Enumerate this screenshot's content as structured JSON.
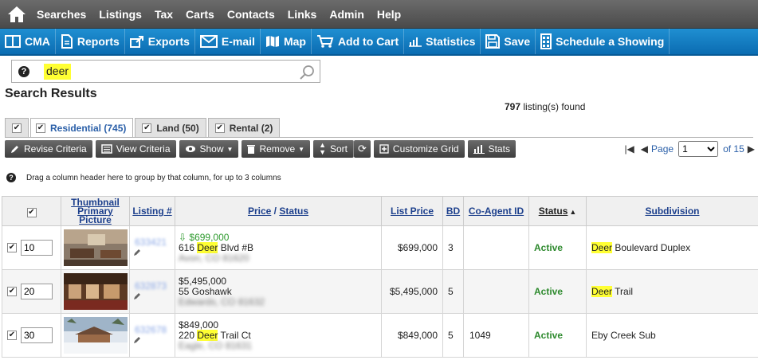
{
  "nav": {
    "items": [
      "Searches",
      "Listings",
      "Tax",
      "Carts",
      "Contacts",
      "Links",
      "Admin",
      "Help"
    ]
  },
  "toolbar": {
    "cma": "CMA",
    "reports": "Reports",
    "exports": "Exports",
    "email": "E-mail",
    "map": "Map",
    "add_to_cart": "Add to Cart",
    "statistics": "Statistics",
    "save": "Save",
    "schedule": "Schedule a Showing"
  },
  "search": {
    "value": "deer"
  },
  "results": {
    "title": "Search Results",
    "count": "797",
    "found_suffix": "listing(s) found"
  },
  "tabs": [
    {
      "label": "Residential (745)",
      "active": true
    },
    {
      "label": "Land (50)",
      "active": false
    },
    {
      "label": "Rental (2)",
      "active": false
    }
  ],
  "actions": {
    "revise": "Revise Criteria",
    "view": "View Criteria",
    "show": "Show",
    "remove": "Remove",
    "sort": "Sort",
    "customize": "Customize Grid",
    "stats": "Stats"
  },
  "pager": {
    "page_label": "Page",
    "page_value": "1",
    "of_label": "of 15"
  },
  "group_hint": "Drag a column header here to group by that column, for up to 3 columns",
  "columns": {
    "thumbnail": "Thumbnail Primary Picture",
    "listing": "Listing #",
    "price": "Price",
    "sep": "/",
    "status_sub": "Status",
    "list_price": "List Price",
    "bd": "BD",
    "coagent": "Co-Agent ID",
    "status": "Status",
    "subdivision": "Subdivision"
  },
  "rows": [
    {
      "seq": "10",
      "listing": "633421",
      "price_line": "$699,000",
      "addr_pre": "616 ",
      "addr_hl": "Deer",
      "addr_post": " Blvd #B",
      "addr_blur": "Avon, CO 81620",
      "list_price": "$699,000",
      "bd": "3",
      "coagent": "",
      "status": "Active",
      "sub_hl": "Deer",
      "sub_post": " Boulevard Duplex"
    },
    {
      "seq": "20",
      "listing": "632873",
      "price_line": "$5,495,000",
      "addr_pre": "55 Goshawk",
      "addr_hl": "",
      "addr_post": "",
      "addr_blur": "Edwards, CO 81632",
      "list_price": "$5,495,000",
      "bd": "5",
      "coagent": "",
      "status": "Active",
      "sub_hl": "Deer",
      "sub_post": " Trail"
    },
    {
      "seq": "30",
      "listing": "632678",
      "price_line": "$849,000",
      "addr_pre": "220 ",
      "addr_hl": "Deer",
      "addr_post": " Trail Ct",
      "addr_blur": "Eagle, CO 81631",
      "list_price": "$849,000",
      "bd": "5",
      "coagent": "1049",
      "status": "Active",
      "sub_hl": "",
      "sub_post": "Eby Creek Sub"
    }
  ]
}
